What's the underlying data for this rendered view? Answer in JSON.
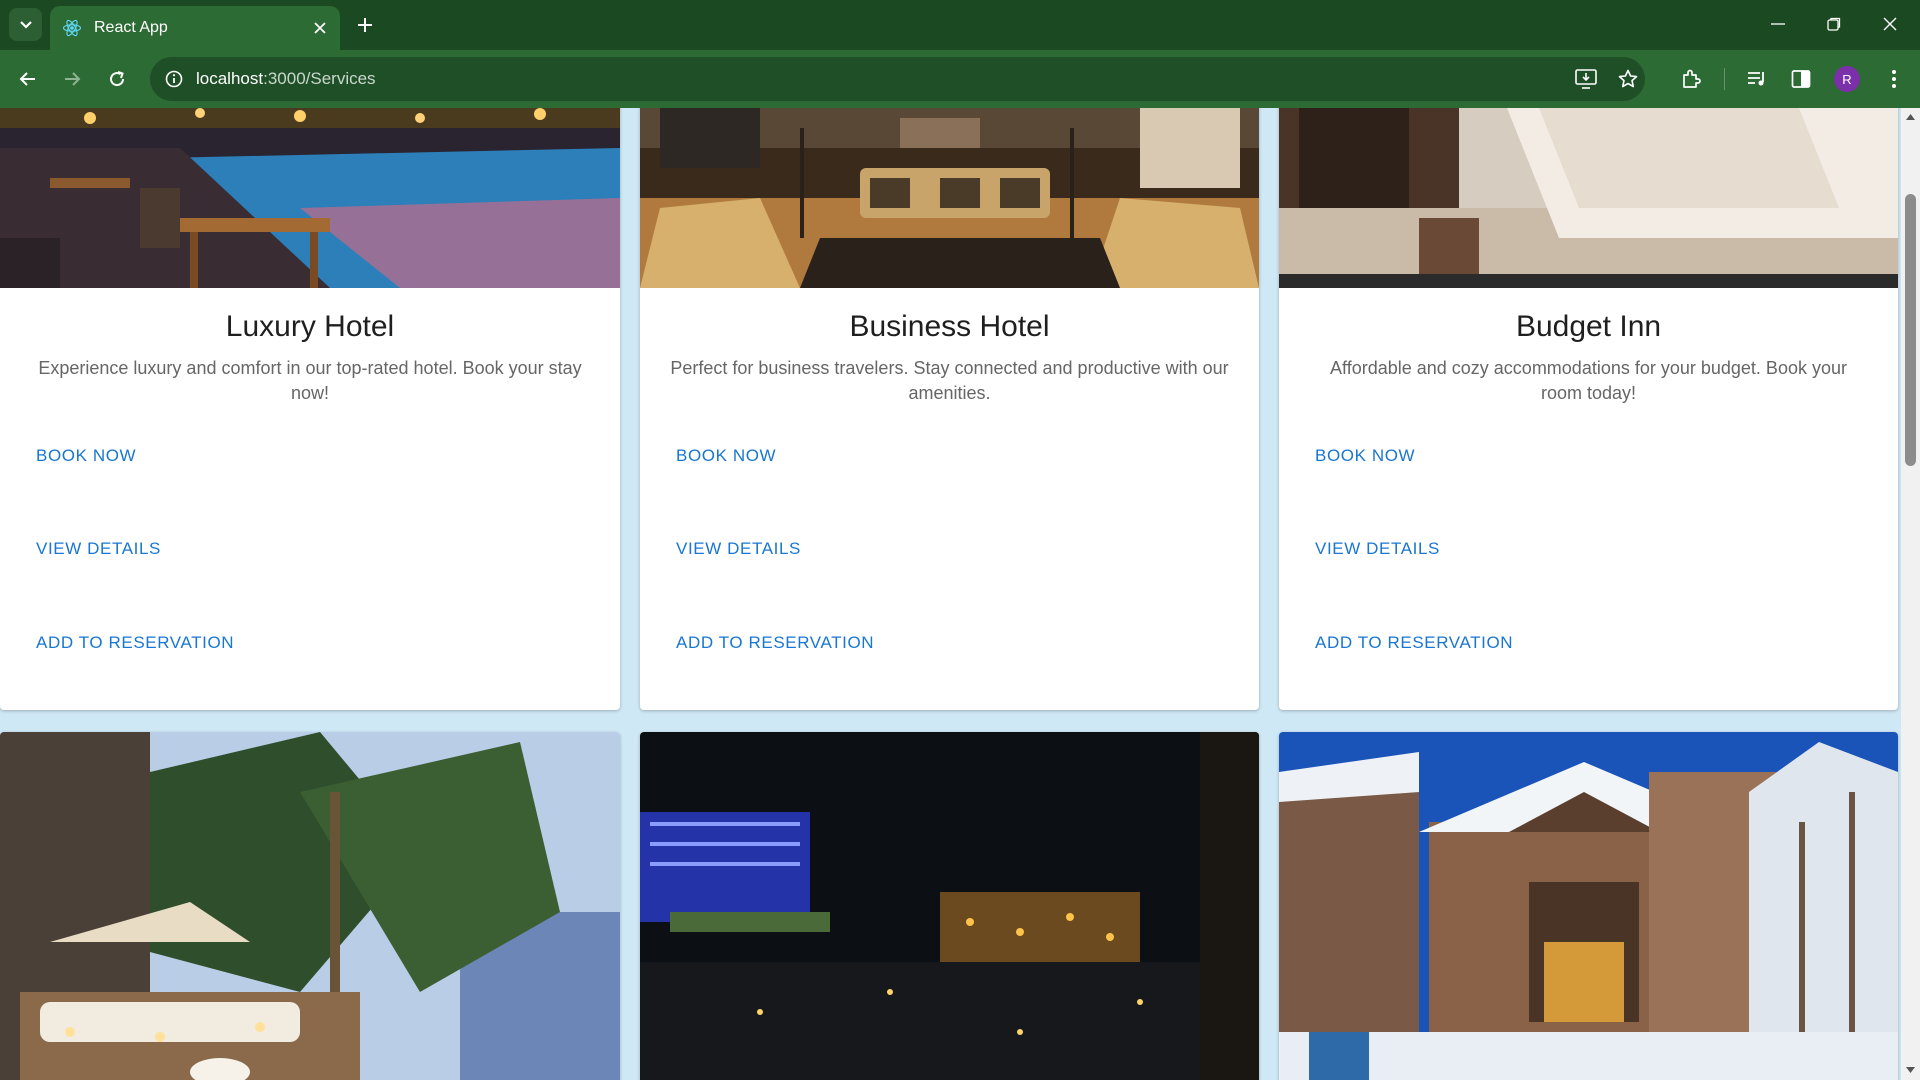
{
  "browser": {
    "tab_title": "React App",
    "url_host": "localhost",
    "url_path": ":3000/Services",
    "avatar_letter": "R",
    "icons": [
      "tab-list-icon",
      "react-favicon-icon",
      "close-icon",
      "plus-icon",
      "minimize-icon",
      "restore-icon",
      "close-window-icon",
      "back-icon",
      "forward-icon",
      "reload-icon",
      "site-info-icon",
      "install-app-icon",
      "star-icon",
      "extensions-icon",
      "media-controls-icon",
      "side-panel-icon",
      "kebab-menu-icon"
    ]
  },
  "colors": {
    "chrome_dark": "#1b4a22",
    "chrome_toolbar": "#2d6b35",
    "page_bg": "#cfe8f5",
    "action_blue": "#1976d2"
  },
  "cards": [
    {
      "title": "Luxury Hotel",
      "description": "Experience luxury and comfort in our top-rated hotel. Book your stay now!",
      "image": "resort-pool-terrace-image",
      "actions": [
        "BOOK NOW",
        "VIEW DETAILS",
        "ADD TO RESERVATION"
      ]
    },
    {
      "title": "Business Hotel",
      "description": "Perfect for business travelers. Stay connected and productive with our amenities.",
      "image": "hotel-lobby-lounge-image",
      "actions": [
        "BOOK NOW",
        "VIEW DETAILS",
        "ADD TO RESERVATION"
      ]
    },
    {
      "title": "Budget Inn",
      "description": "Affordable and cozy accommodations for your budget. Book your room today!",
      "image": "hotel-bedroom-image",
      "actions": [
        "BOOK NOW",
        "VIEW DETAILS",
        "ADD TO RESERVATION"
      ]
    },
    {
      "image": "tropical-beach-resort-image"
    },
    {
      "image": "city-night-skyline-image"
    },
    {
      "image": "snowy-mountain-lodge-image"
    }
  ]
}
